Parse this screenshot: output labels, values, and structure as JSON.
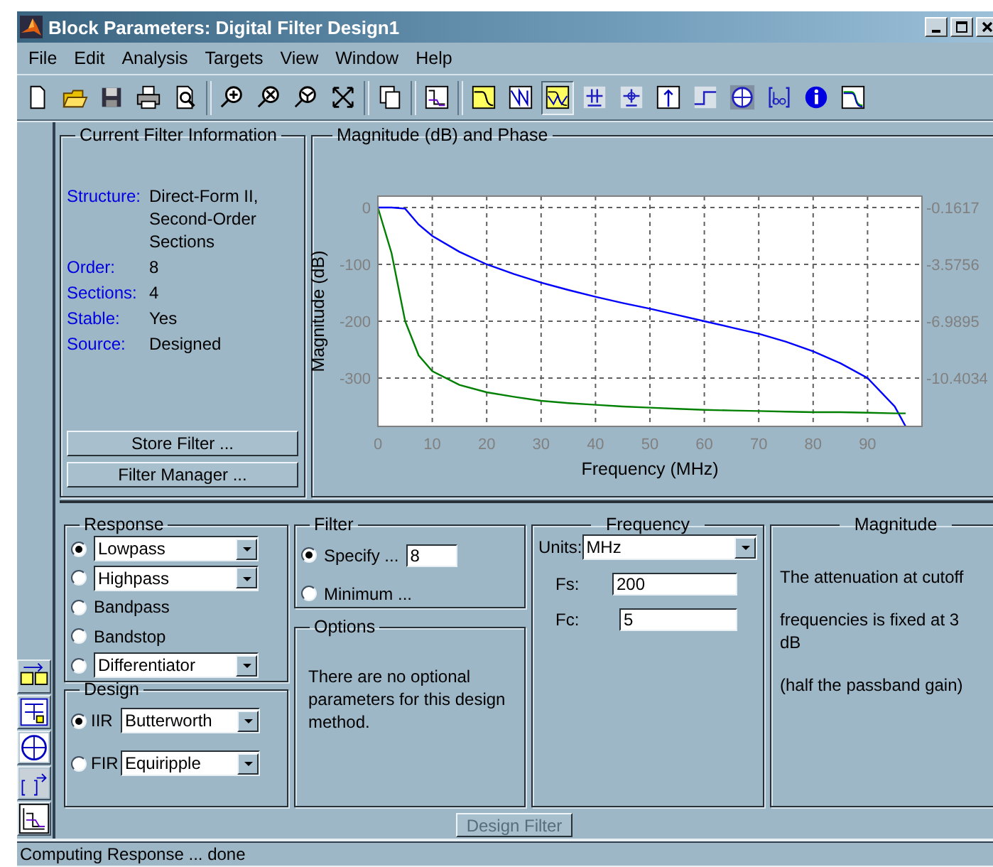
{
  "window": {
    "title": "Block Parameters: Digital Filter Design1"
  },
  "menu": [
    "File",
    "Edit",
    "Analysis",
    "Targets",
    "View",
    "Window",
    "Help"
  ],
  "toolbar": [
    {
      "kind": "new"
    },
    {
      "kind": "open"
    },
    {
      "kind": "save"
    },
    {
      "kind": "print"
    },
    {
      "kind": "preview"
    },
    {
      "kind": "separator"
    },
    {
      "kind": "zoom-in"
    },
    {
      "kind": "zoom-out"
    },
    {
      "kind": "zoom-x"
    },
    {
      "kind": "full-view"
    },
    {
      "kind": "separator"
    },
    {
      "kind": "copy"
    },
    {
      "kind": "separator"
    },
    {
      "kind": "design-mode"
    },
    {
      "kind": "separator"
    },
    {
      "kind": "magnitude",
      "selected": false
    },
    {
      "kind": "phase",
      "selected": false
    },
    {
      "kind": "mag-phase",
      "selected": true
    },
    {
      "kind": "group-delay",
      "selected": false
    },
    {
      "kind": "phase-delay",
      "selected": false
    },
    {
      "kind": "impulse",
      "selected": false
    },
    {
      "kind": "step",
      "selected": false
    },
    {
      "kind": "pole-zero",
      "selected": false
    },
    {
      "kind": "coefficients",
      "selected": false
    },
    {
      "kind": "info",
      "selected": false
    },
    {
      "kind": "mag-estimate",
      "selected": false
    }
  ],
  "filter_info": {
    "title": "Current Filter Information",
    "rows": [
      {
        "label": "Structure:",
        "value": "Direct-Form II, Second-Order Sections"
      },
      {
        "label": "Order:",
        "value": "8"
      },
      {
        "label": "Sections:",
        "value": "4"
      },
      {
        "label": "Stable:",
        "value": "Yes"
      },
      {
        "label": "Source:",
        "value": "Designed"
      }
    ],
    "buttons": [
      "Store Filter ...",
      "Filter Manager ..."
    ]
  },
  "analysis": {
    "title": "Magnitude (dB) and Phase",
    "chart_data": {
      "type": "line",
      "xlabel": "Frequency (MHz)",
      "ylabel": "Magnitude (dB)",
      "xlim": [
        0,
        100
      ],
      "ylim": [
        -385,
        20
      ],
      "xticks": [
        0,
        10,
        20,
        30,
        40,
        50,
        60,
        70,
        80,
        90
      ],
      "yticks": [
        0,
        -100,
        -200,
        -300
      ],
      "grid": true,
      "x": [
        0,
        2.5,
        5,
        7.5,
        10,
        15,
        20,
        25,
        30,
        35,
        40,
        45,
        50,
        55,
        60,
        65,
        70,
        75,
        80,
        85,
        90,
        95,
        97
      ],
      "series": [
        {
          "color": "#0000ff",
          "values": [
            0,
            0,
            -2,
            -30,
            -50,
            -78,
            -100,
            -117,
            -132,
            -145,
            -157,
            -168,
            -178,
            -189,
            -200,
            -211,
            -222,
            -236,
            -253,
            -274,
            -300,
            -350,
            -385
          ]
        },
        {
          "color": "#008000",
          "values": [
            0,
            -80,
            -200,
            -260,
            -288,
            -312,
            -325,
            -333,
            -340,
            -344,
            -347,
            -350,
            -352,
            -354,
            -356,
            -357,
            -358,
            -359,
            -360,
            -360,
            -361,
            -362,
            -362
          ]
        }
      ]
    },
    "right_axis_labels": [
      "-0.1617",
      "-3.5756",
      "-6.9895",
      "-10.4034"
    ]
  },
  "response": {
    "title": "Response",
    "options": [
      {
        "kind": "dropdown",
        "label": "Lowpass",
        "selected": true
      },
      {
        "kind": "dropdown",
        "label": "Highpass",
        "selected": false
      },
      {
        "kind": "plain",
        "label": "Bandpass",
        "selected": false
      },
      {
        "kind": "plain",
        "label": "Bandstop",
        "selected": false
      },
      {
        "kind": "dropdown",
        "label": "Differentiator",
        "selected": false
      }
    ]
  },
  "design": {
    "title": "Design",
    "options": [
      {
        "label": "IIR",
        "value": "Butterworth",
        "selected": true
      },
      {
        "label": "FIR",
        "value": "Equiripple",
        "selected": false
      }
    ]
  },
  "filter_order": {
    "title": "Filter",
    "options": [
      {
        "label": "Specify ...",
        "value": "8",
        "selected": true
      },
      {
        "label": "Minimum ...",
        "selected": false
      }
    ]
  },
  "options": {
    "title": "Options",
    "text": "There are no optional parameters for this design method."
  },
  "frequency": {
    "title": "Frequency",
    "units_label": "Units:",
    "units": "MHz",
    "fields": [
      {
        "label": "Fs:",
        "value": "200"
      },
      {
        "label": "Fc:",
        "value": "5"
      }
    ]
  },
  "magnitude": {
    "title": "Magnitude",
    "lines": [
      "The attenuation at cutoff",
      "frequencies is fixed at 3 dB",
      "(half the passband gain)"
    ]
  },
  "design_button": {
    "label": "Design Filter",
    "disabled": true
  },
  "status_bar": "Computing Response ... done"
}
